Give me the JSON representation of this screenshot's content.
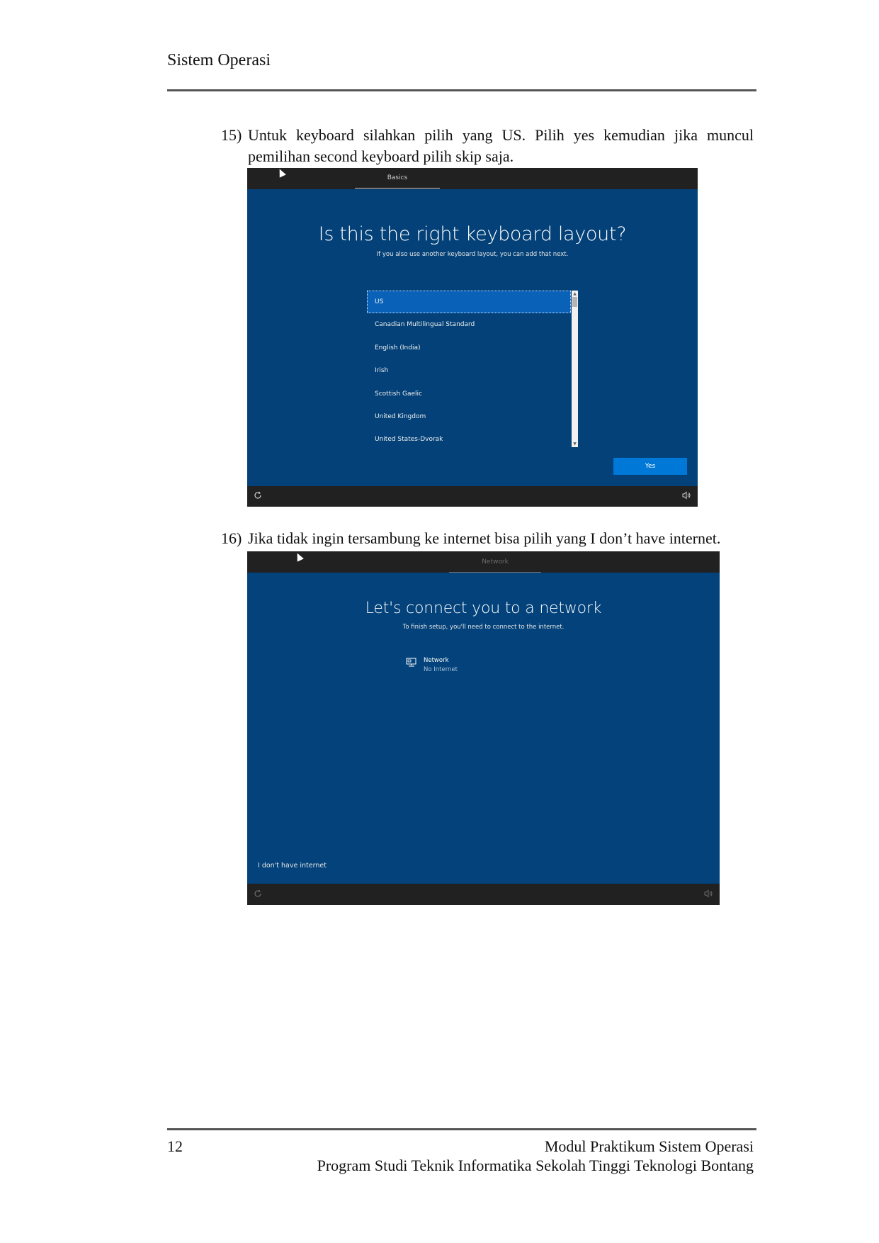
{
  "header": {
    "title": "Sistem Operasi"
  },
  "steps": [
    {
      "number": "15)",
      "text": "Untuk keyboard silahkan pilih yang US. Pilih yes kemudian jika muncul pemilihan second keyboard pilih skip saja."
    },
    {
      "number": "16)",
      "text": "Jika tidak ingin tersambung ke internet bisa pilih yang I don’t have internet."
    }
  ],
  "screenshot1": {
    "tab": "Basics",
    "heading": "Is this the right keyboard layout?",
    "subheading": "If you also use another keyboard layout, you can add that next.",
    "layouts": [
      "US",
      "Canadian Multilingual Standard",
      "English (India)",
      "Irish",
      "Scottish Gaelic",
      "United Kingdom",
      "United States-Dvorak"
    ],
    "selected": "US",
    "yes_label": "Yes",
    "icons": {
      "left": "accessibility-icon",
      "right": "volume-icon"
    }
  },
  "screenshot2": {
    "tab": "Network",
    "heading": "Let's connect you to a network",
    "subheading": "To finish setup, you'll need to connect to the internet.",
    "network_name": "Network",
    "network_status": "No Internet",
    "no_internet_label": "I don't have internet",
    "icons": {
      "left": "accessibility-icon",
      "right": "volume-icon",
      "network": "ethernet-icon"
    }
  },
  "footer": {
    "page_number": "12",
    "line1": "Modul Praktikum Sistem Operasi",
    "line2": "Program Studi Teknik Informatika Sekolah Tinggi Teknologi Bontang"
  }
}
